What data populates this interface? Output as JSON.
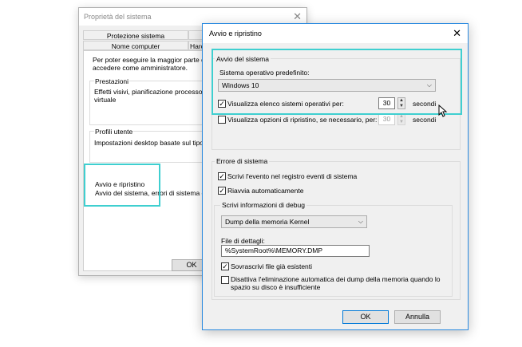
{
  "system_properties": {
    "title": "Proprietà del sistema",
    "tabs_row1": [
      "Protezione sistema"
    ],
    "tabs_row2": [
      "Nome computer",
      "Hardw"
    ],
    "admin_note": [
      "Per poter eseguire la maggior parte delle m",
      "accedere come amministratore."
    ],
    "performance": {
      "title": "Prestazioni",
      "text": [
        "Effetti visivi, pianificazione processore, uti",
        "virtuale"
      ]
    },
    "user_profiles": {
      "title": "Profili utente",
      "text": "Impostazioni desktop basate sul tipo di ac"
    },
    "startup_recovery": {
      "title": "Avvio e ripristino",
      "text": "Avvio del sistema, errori di sistema e infom"
    },
    "ok_label": "OK"
  },
  "startup_recovery_dialog": {
    "title": "Avvio e ripristino",
    "system_startup": {
      "group_label": "Avvio del sistema",
      "default_os_label": "Sistema operativo predefinito:",
      "default_os_value": "Windows 10",
      "show_os_list_label": "Visualizza elenco sistemi operativi per:",
      "show_os_list_checked": true,
      "show_os_list_seconds": "30",
      "show_recovery_label": "Visualizza opzioni di ripristino, se necessario, per:",
      "show_recovery_checked": false,
      "show_recovery_seconds": "30",
      "seconds_unit": "secondi"
    },
    "system_failure": {
      "group_label": "Errore di sistema",
      "write_event_label": "Scrivi l'evento nel registro eventi di sistema",
      "write_event_checked": true,
      "auto_restart_label": "Riavvia automaticamente",
      "auto_restart_checked": true,
      "debug_info": {
        "group_label": "Scrivi informazioni di debug",
        "dump_type": "Dump della memoria Kernel",
        "dump_file_label": "File di dettagli:",
        "dump_file_value": "%SystemRoot%\\MEMORY.DMP",
        "overwrite_label": "Sovrascrivi file già esistenti",
        "overwrite_checked": true,
        "disable_auto_delete_label": [
          "Disattiva l'eliminazione automatica dei dump della memoria quando lo",
          "spazio su disco è insufficiente"
        ],
        "disable_auto_delete_checked": false
      }
    },
    "ok_label": "OK",
    "cancel_label": "Annulla"
  },
  "icons": {
    "close": "close-icon",
    "dropdown": "chevron-down-icon",
    "spin_up": "spin-up-icon",
    "spin_down": "spin-down-icon",
    "check": "checkmark-icon",
    "cursor": "mouse-pointer-icon"
  },
  "colors": {
    "highlight": "#3fcfd0",
    "active_border": "#2a8ae0",
    "default_button_border": "#0078d7"
  }
}
